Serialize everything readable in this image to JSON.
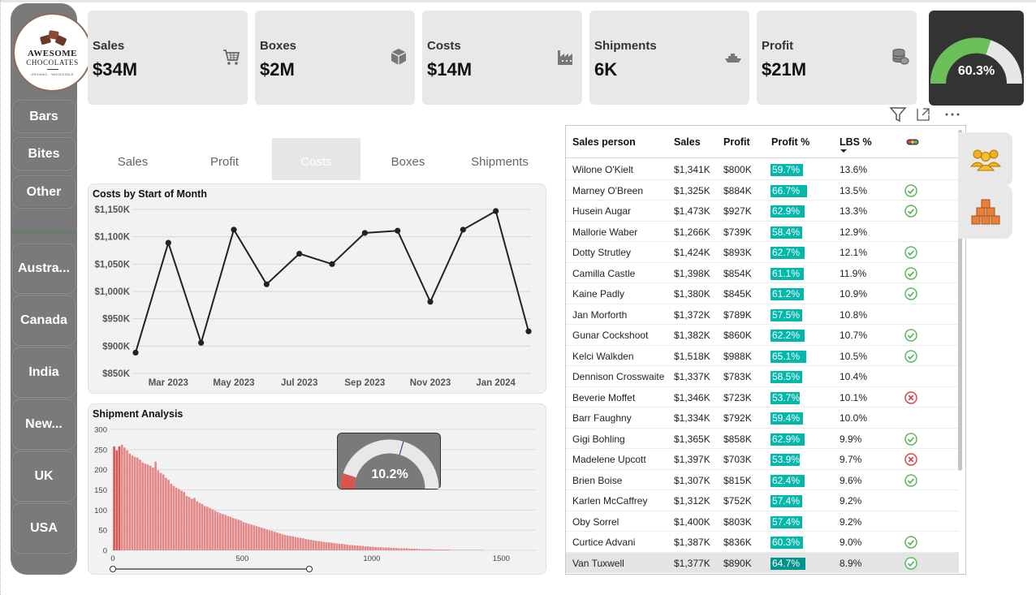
{
  "logo": {
    "line1": "AWESOME",
    "line2": "CHOCOLATES",
    "line3": "ORGANIC · WHOLESALE"
  },
  "sidebar": {
    "products": [
      "Bars",
      "Bites",
      "Other"
    ],
    "countries": [
      "Austra...",
      "Canada",
      "India",
      "New...",
      "UK",
      "USA"
    ]
  },
  "kpis": [
    {
      "label": "Sales",
      "value": "$34M",
      "icon": "cart-icon"
    },
    {
      "label": "Boxes",
      "value": "$2M",
      "icon": "box-icon"
    },
    {
      "label": "Costs",
      "value": "$14M",
      "icon": "factory-icon"
    },
    {
      "label": "Shipments",
      "value": "6K",
      "icon": "ship-icon"
    },
    {
      "label": "Profit",
      "value": "$21M",
      "icon": "coins-icon"
    }
  ],
  "profit_gauge": {
    "value_text": "60.3%",
    "fraction": 0.603,
    "fill_color": "#6bbf59"
  },
  "tabs": [
    "Sales",
    "Profit",
    "Costs",
    "Boxes",
    "Shipments"
  ],
  "active_tab": 2,
  "costs_chart": {
    "title": "Costs by Start of Month",
    "y_ticks": [
      "$1,150K",
      "$1,100K",
      "$1,050K",
      "$1,000K",
      "$950K",
      "$900K",
      "$850K"
    ],
    "x_ticks": [
      "Mar 2023",
      "May 2023",
      "Jul 2023",
      "Sep 2023",
      "Nov 2023",
      "Jan 2024"
    ]
  },
  "shipment_chart": {
    "title": "Shipment Analysis",
    "y_ticks": [
      "300",
      "250",
      "200",
      "150",
      "100",
      "50",
      "0"
    ],
    "x_ticks": [
      "0",
      "500",
      "1000",
      "1500"
    ],
    "gauge_text": "10.2%",
    "gauge_fraction": 0.102
  },
  "chart_data": [
    {
      "type": "line",
      "title": "Costs by Start of Month",
      "x": [
        "Feb 2023",
        "Mar 2023",
        "Apr 2023",
        "May 2023",
        "Jun 2023",
        "Jul 2023",
        "Aug 2023",
        "Sep 2023",
        "Oct 2023",
        "Nov 2023",
        "Dec 2023",
        "Jan 2024",
        "Feb 2024"
      ],
      "values": [
        888,
        1089,
        906,
        1113,
        1013,
        1069,
        1050,
        1107,
        1111,
        981,
        1113,
        1147,
        927
      ],
      "unit": "$K",
      "ylim": [
        850,
        1150
      ],
      "grid": true,
      "color": "#222222"
    },
    {
      "type": "bar",
      "title": "Shipment Analysis",
      "bin_width": 10,
      "x_start": 0,
      "values": [
        258,
        248,
        258,
        262,
        255,
        248,
        240,
        235,
        232,
        230,
        225,
        218,
        215,
        213,
        210,
        205,
        220,
        198,
        192,
        188,
        180,
        175,
        165,
        160,
        155,
        152,
        148,
        145,
        135,
        132,
        128,
        130,
        122,
        118,
        115,
        110,
        108,
        105,
        102,
        98,
        95,
        92,
        90,
        88,
        85,
        83,
        80,
        78,
        76,
        74,
        70,
        68,
        66,
        64,
        62,
        60,
        58,
        56,
        54,
        52,
        50,
        48,
        46,
        44,
        42,
        40,
        38,
        37,
        36,
        35,
        33,
        32,
        31,
        30,
        28,
        27,
        26,
        25,
        24,
        23,
        22,
        21,
        20,
        20,
        19,
        18,
        17,
        16,
        16,
        15,
        14,
        13,
        13,
        12,
        12,
        11,
        11,
        10,
        10,
        9,
        9,
        8,
        8,
        8,
        7,
        7,
        7,
        6,
        6,
        6,
        5,
        5,
        5,
        5,
        4,
        4,
        4,
        4,
        3,
        3,
        3,
        3,
        3,
        2,
        2,
        2,
        2,
        2,
        2,
        2,
        1,
        1,
        1,
        1,
        1,
        1,
        1,
        1,
        1,
        1,
        1,
        1,
        1,
        0,
        0,
        0,
        0
      ],
      "highlight_bins": 3,
      "xlim": [
        0,
        1640
      ],
      "ylim": [
        0,
        300
      ],
      "color": "#e48586",
      "highlight_color": "#d9534f"
    }
  ],
  "table": {
    "headers": [
      "Sales person",
      "Sales",
      "Profit",
      "Profit %",
      "LBS %"
    ],
    "rows": [
      {
        "name": "Wilone O'Kielt",
        "sales": "$1,341K",
        "profit": "$800K",
        "pct": "59.7%",
        "pct_value": 59.7,
        "lbs": "13.6%",
        "status": "none"
      },
      {
        "name": "Marney O'Breen",
        "sales": "$1,325K",
        "profit": "$884K",
        "pct": "66.7%",
        "pct_value": 66.7,
        "lbs": "13.5%",
        "status": "check"
      },
      {
        "name": "Husein Augar",
        "sales": "$1,473K",
        "profit": "$927K",
        "pct": "62.9%",
        "pct_value": 62.9,
        "lbs": "13.3%",
        "status": "check"
      },
      {
        "name": "Mallorie Waber",
        "sales": "$1,266K",
        "profit": "$739K",
        "pct": "58.4%",
        "pct_value": 58.4,
        "lbs": "12.9%",
        "status": "none"
      },
      {
        "name": "Dotty Strutley",
        "sales": "$1,424K",
        "profit": "$893K",
        "pct": "62.7%",
        "pct_value": 62.7,
        "lbs": "12.1%",
        "status": "check"
      },
      {
        "name": "Camilla Castle",
        "sales": "$1,398K",
        "profit": "$854K",
        "pct": "61.1%",
        "pct_value": 61.1,
        "lbs": "11.9%",
        "status": "check"
      },
      {
        "name": "Kaine Padly",
        "sales": "$1,380K",
        "profit": "$845K",
        "pct": "61.2%",
        "pct_value": 61.2,
        "lbs": "10.9%",
        "status": "check"
      },
      {
        "name": "Jan Morforth",
        "sales": "$1,372K",
        "profit": "$789K",
        "pct": "57.5%",
        "pct_value": 57.5,
        "lbs": "10.8%",
        "status": "none"
      },
      {
        "name": "Gunar Cockshoot",
        "sales": "$1,382K",
        "profit": "$860K",
        "pct": "62.2%",
        "pct_value": 62.2,
        "lbs": "10.7%",
        "status": "check"
      },
      {
        "name": "Kelci Walkden",
        "sales": "$1,518K",
        "profit": "$988K",
        "pct": "65.1%",
        "pct_value": 65.1,
        "lbs": "10.5%",
        "status": "check"
      },
      {
        "name": "Dennison Crosswaite",
        "sales": "$1,337K",
        "profit": "$783K",
        "pct": "58.5%",
        "pct_value": 58.5,
        "lbs": "10.4%",
        "status": "none"
      },
      {
        "name": "Beverie Moffet",
        "sales": "$1,346K",
        "profit": "$723K",
        "pct": "53.7%",
        "pct_value": 53.7,
        "lbs": "10.1%",
        "status": "cross"
      },
      {
        "name": "Barr Faughny",
        "sales": "$1,334K",
        "profit": "$792K",
        "pct": "59.4%",
        "pct_value": 59.4,
        "lbs": "10.0%",
        "status": "none"
      },
      {
        "name": "Gigi Bohling",
        "sales": "$1,365K",
        "profit": "$858K",
        "pct": "62.9%",
        "pct_value": 62.9,
        "lbs": "9.9%",
        "status": "check"
      },
      {
        "name": "Madelene Upcott",
        "sales": "$1,397K",
        "profit": "$703K",
        "pct": "53.9%",
        "pct_value": 53.9,
        "lbs": "9.7%",
        "status": "cross"
      },
      {
        "name": "Brien Boise",
        "sales": "$1,307K",
        "profit": "$815K",
        "pct": "62.4%",
        "pct_value": 62.4,
        "lbs": "9.6%",
        "status": "check"
      },
      {
        "name": "Karlen McCaffrey",
        "sales": "$1,312K",
        "profit": "$752K",
        "pct": "57.4%",
        "pct_value": 57.4,
        "lbs": "9.2%",
        "status": "none"
      },
      {
        "name": "Oby Sorrel",
        "sales": "$1,400K",
        "profit": "$803K",
        "pct": "57.4%",
        "pct_value": 57.4,
        "lbs": "9.2%",
        "status": "none"
      },
      {
        "name": "Curtice Advani",
        "sales": "$1,387K",
        "profit": "$836K",
        "pct": "60.3%",
        "pct_value": 60.3,
        "lbs": "9.0%",
        "status": "check"
      },
      {
        "name": "Van Tuxwell",
        "sales": "$1,377K",
        "profit": "$890K",
        "pct": "64.7%",
        "pct_value": 64.7,
        "lbs": "8.9%",
        "status": "check"
      }
    ]
  },
  "colors": {
    "teal": "#01b8aa",
    "check": "#5cb85c",
    "cross": "#e04343",
    "sidebar": "#7a7a7a"
  }
}
